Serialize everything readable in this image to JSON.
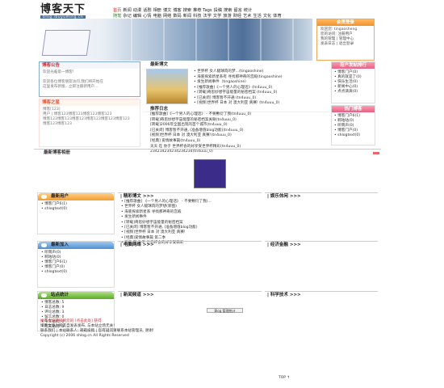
{
  "logo": {
    "title": "博客天下",
    "url": "blog.ibuyuming.cn"
  },
  "nav": [
    {
      "t": "首页",
      "c": "red"
    },
    {
      "t": "新闻"
    },
    {
      "t": "动漫"
    },
    {
      "t": "话剧"
    },
    {
      "t": "相册"
    },
    {
      "t": "博文"
    },
    {
      "t": "博客"
    },
    {
      "t": "搜索"
    },
    {
      "t": "推荐 Tags"
    },
    {
      "t": "投稿"
    },
    {
      "t": "搜索"
    },
    {
      "t": "留言"
    },
    {
      "t": "统计"
    },
    {
      "t": "随笔",
      "c": "green"
    },
    {
      "t": "杂记"
    },
    {
      "t": "编辑"
    },
    {
      "t": "心情"
    },
    {
      "t": "电脑"
    },
    {
      "t": "网络"
    },
    {
      "t": "数码"
    },
    {
      "t": "新闻"
    },
    {
      "t": "科技"
    },
    {
      "t": "法学"
    },
    {
      "t": "文学"
    },
    {
      "t": "旅游"
    },
    {
      "t": "财经"
    },
    {
      "t": "艺术"
    },
    {
      "t": "生活"
    },
    {
      "t": "文化"
    },
    {
      "t": "体育"
    }
  ],
  "login": {
    "title": "会员登录",
    "lines": [
      "欢迎您: tingaosheng",
      "您的访问: 注册用户",
      "我的管理 | 管理中心",
      "发表日志 | 退出登录"
    ]
  },
  "announce": {
    "title": "博客公告",
    "lines": [
      "欢迎光临第一博客!",
      "",
      "欢迎各位博客朋友访问,我们将开始在",
      "这里发布新版...立即注册新用户..."
    ]
  },
  "blogstar": {
    "title": "博客之星",
    "lines": [
      "博客[123]",
      "用户 | 博客123博客123博客123博客123",
      "博客123博客123博客123博客123博客123博客123",
      "博客123博客123"
    ]
  },
  "news": {
    "title": "最新博文",
    "items": [
      "• 世界杯 女人腿球肉的梦...(tingaoshine)",
      "• 海底探索新星系有 寻找那神奇的宫殿(tingaoshine)",
      "• 发生新闻事件（tingaoshine）",
      "• [推荐歌曲]《一个男人的心理话》(tn4uuu_0)",
      "• [转载]奇思妙想宇宙能量的秘密档案 (tn4uuu_0)",
      "• [已关闭] 博客暂不开通 (tn4uuu_0)",
      "• [视频]世界杯 日本 对 澳大利亚 真赛!  (tn4uuu_0)"
    ]
  },
  "recommend": {
    "title": "推荐日志",
    "items": [
      "[推荐歌曲]《一个男人的心理话》 - 不要敷衍了我(tn4uuu_0)",
      "[转载]奇思妙想宇宙能量的秘密档案关联(tn4uuu_0)",
      "[转载]2006年全国出现的首个城市(tn4uuu_0)",
      "[已关闭] 博客暂不开通, (准备增值blog功能)(tn4uuu_0)",
      "[视频]世界杯 日本 对 澳大利亚 真赛!(tn4uuu_0)",
      "[经典] 爱情故事篇(tn4uuu_0)",
      "天天 在 你于 世界杯会的好享受世界杯精彩(tn4uuu_0)",
      "234234234234234234(tn4uuu_0)"
    ]
  },
  "user_rank": {
    "title": "用户发帖排行",
    "items": [
      "• 博客门户(0)",
      "• 真的就是了(0)",
      "• 快乐生活(0)",
      "• 新闻中心(0)",
      "• 点点滴滴(0)"
    ]
  },
  "hot_blog": {
    "title": "热门博客",
    "items": [
      "• 博客门户6(1)",
      "• 啊咕咕(0)",
      "• 听雨声(0)",
      "• 博客门户(0)",
      "• shlogtext(0)"
    ]
  },
  "section_title": "最新博客相册",
  "latest_users": {
    "title": "最新用户",
    "items": [
      "• 博客门户6(1)",
      "• shlogtext(0)"
    ]
  },
  "members": {
    "title": "最新加入",
    "items": [
      "• 听雨声(0)",
      "• 啊咕咕(0)",
      "• 博客门户6(1)",
      "• 博客门户(0)",
      "• shlogtext(0)"
    ]
  },
  "stats": {
    "title": "站点统计",
    "items": [
      "• 博客总数: 5",
      "• 日志总数: 9",
      "• 评论总数: 3",
      "• 留言总数: 0",
      "• 今天访问: 0",
      "• 昨天访问: 0"
    ]
  },
  "col_hot": {
    "title": "| 精彩博文 >>>",
    "items": [
      "• [推荐歌曲] 《一个男人的心理话》 - 不要敷衍了我(...",
      "• 世界杯 女人腿球肉的梦想(新图)",
      "• 海底探索新星系 寻找那神奇的宫殿",
      "• 发生新闻事件",
      "• [转载]奇思妙想宇宙能量的秘密档案",
      "• [已关闭] 博客暂不开通, (准备增值blog功能)",
      "• [视频]世界杯 日本 对 澳大利亚 真赛!",
      "• [经典]爱情故事篇 第二季",
      "• 天天 在 你于 世界杯会的好享受精彩"
    ]
  },
  "col_music": {
    "title": "| 娱乐休闲 >>>"
  },
  "col_net": {
    "title": "| 电脑网络 >>>"
  },
  "col_life": {
    "title": "| 经济金融 >>>"
  },
  "col_news": {
    "title": "| 新闻频道 >>>"
  },
  "col_sci": {
    "title": "| 科学技术 >>>"
  },
  "counter": "Blog 管理统计",
  "footer": {
    "link": "推荐本站链接到您的 [点击此处] 获得",
    "lines": [
      "博客文章为网友自发表发布, 与本站立场无关!",
      "联系我们 | 本站联系人: 邮箱投稿 | 您有疑问请联系本站管理员, 谢谢!",
      "Copyright (c) 2006 shlog.cn All Rights Reserved"
    ]
  },
  "top": "TOP ↑"
}
